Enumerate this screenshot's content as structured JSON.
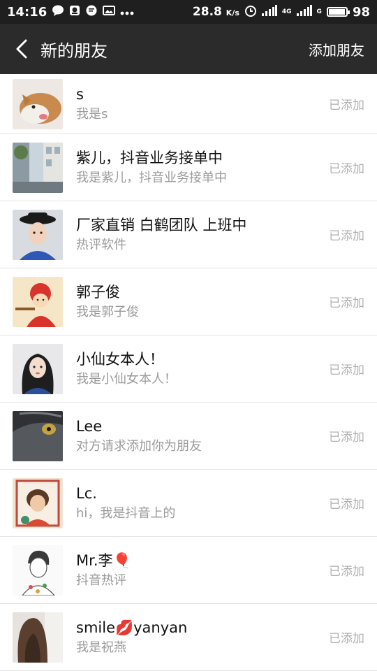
{
  "status_bar": {
    "time": "14:16",
    "speed": "28.8",
    "speed_unit": "K/s",
    "net_label_1": "4G",
    "net_label_2": "G",
    "battery": "98"
  },
  "header": {
    "title": "新的朋友",
    "action": "添加朋友"
  },
  "friends": [
    {
      "name": "s",
      "message": "我是s",
      "status": "已添加",
      "avatar": "avatar-dog"
    },
    {
      "name": "紫儿，抖音业务接单中",
      "message": "我是紫儿，抖音业务接单中",
      "status": "已添加",
      "avatar": "avatar-street"
    },
    {
      "name": "厂家直销 白鹤团队 上班中",
      "message": "热评软件",
      "status": "已添加",
      "avatar": "avatar-man-hat"
    },
    {
      "name": "郭子俊",
      "message": "我是郭子俊",
      "status": "已添加",
      "avatar": "avatar-cartoon"
    },
    {
      "name": "小仙女本人！",
      "message": "我是小仙女本人！",
      "status": "已添加",
      "avatar": "avatar-girl"
    },
    {
      "name": "Lee",
      "message": "对方请求添加你为朋友",
      "status": "已添加",
      "avatar": "avatar-cat"
    },
    {
      "name": "Lc.",
      "message": "hi，我是抖音上的",
      "status": "已添加",
      "avatar": "avatar-painting"
    },
    {
      "name": "Mr.李🎈",
      "message": "抖音热评",
      "status": "已添加",
      "avatar": "avatar-sketch"
    },
    {
      "name": "smile💋yanyan",
      "message": "我是祝燕",
      "status": "已添加",
      "avatar": "avatar-woman-hair"
    }
  ]
}
